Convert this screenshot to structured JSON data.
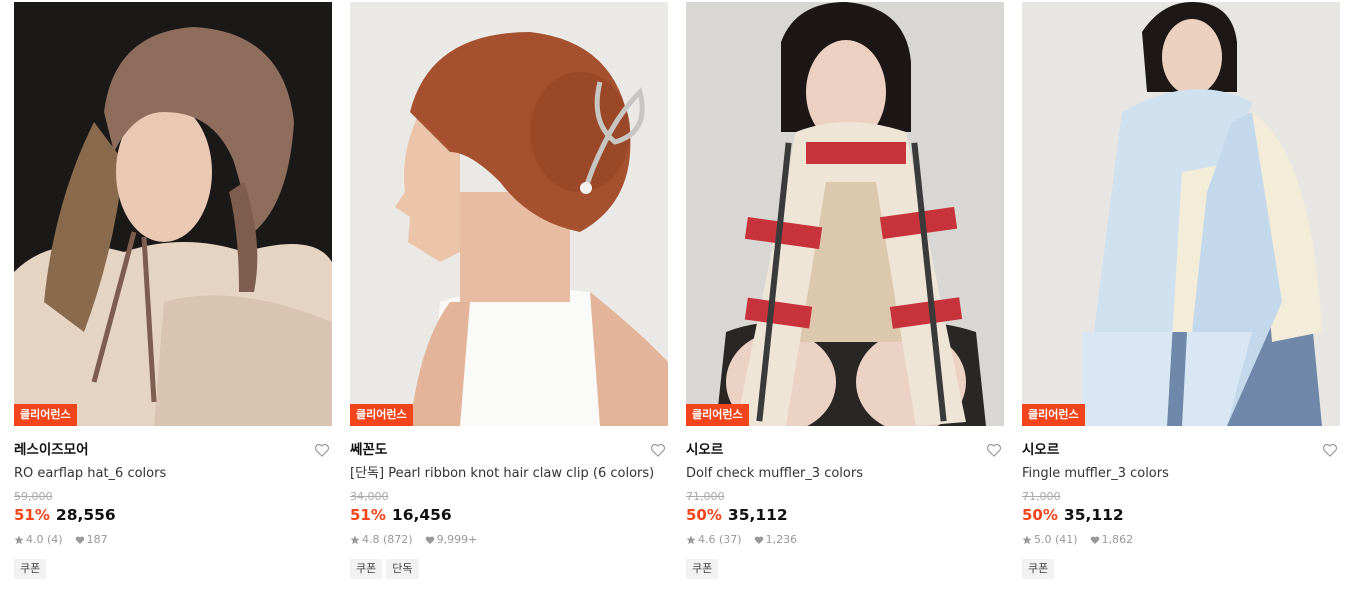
{
  "products": [
    {
      "badge": "클리어런스",
      "brand": "레스이즈모어",
      "name": "RO earflap hat_6 colors",
      "original_price": "59,000",
      "discount": "51%",
      "price": "28,556",
      "rating": "4.0",
      "review_count": "(4)",
      "likes": "187",
      "tags": [
        "쿠폰"
      ],
      "image_icon": "knit-earflap-hat-photo"
    },
    {
      "badge": "클리어런스",
      "brand": "쎄꼰도",
      "name": "[단독] Pearl ribbon knot hair claw clip (6 colors)",
      "original_price": "34,000",
      "discount": "51%",
      "price": "16,456",
      "rating": "4.8",
      "review_count": "(872)",
      "likes": "9,999+",
      "tags": [
        "쿠폰",
        "단독"
      ],
      "image_icon": "hair-claw-clip-photo"
    },
    {
      "badge": "클리어런스",
      "brand": "시오르",
      "name": "Dolf check muffler_3 colors",
      "original_price": "71,000",
      "discount": "50%",
      "price": "35,112",
      "rating": "4.6",
      "review_count": "(37)",
      "likes": "1,236",
      "tags": [
        "쿠폰"
      ],
      "image_icon": "check-muffler-photo"
    },
    {
      "badge": "클리어런스",
      "brand": "시오르",
      "name": "Fingle muffler_3 colors",
      "original_price": "71,000",
      "discount": "50%",
      "price": "35,112",
      "rating": "5.0",
      "review_count": "(41)",
      "likes": "1,862",
      "tags": [
        "쿠폰"
      ],
      "image_icon": "fringe-muffler-photo"
    }
  ],
  "colors": {
    "accent": "#f3451c",
    "text": "#111111",
    "muted": "#999999",
    "tag_bg": "#f2f2f2"
  }
}
